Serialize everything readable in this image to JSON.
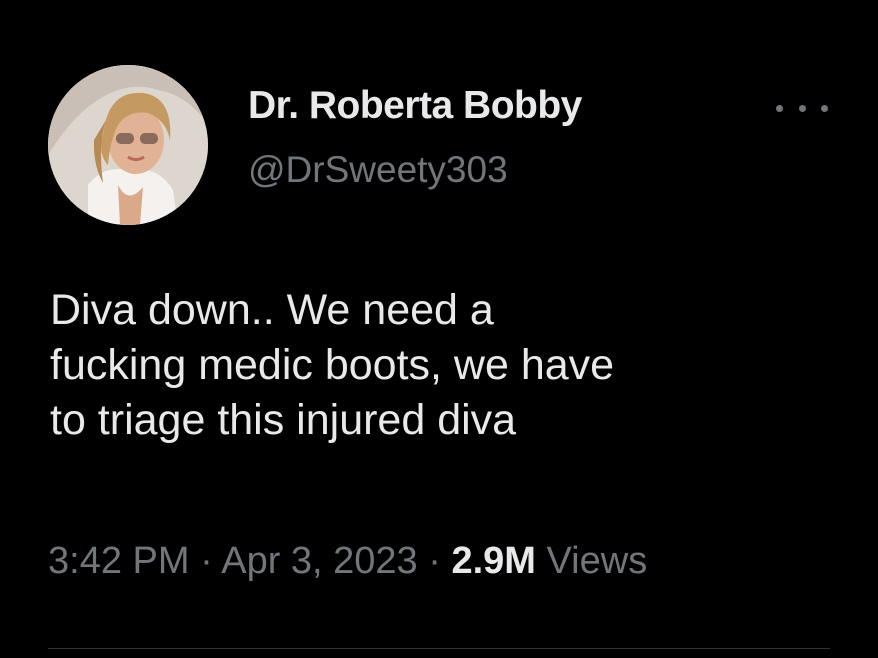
{
  "user": {
    "display_name": "Dr. Roberta Bobby",
    "handle": "@DrSweety303",
    "avatar_icon": "profile-photo"
  },
  "tweet": {
    "lines": [
      "Diva down.. We need a",
      "fucking medic boots, we have",
      "to triage this injured diva"
    ]
  },
  "meta": {
    "time": "3:42 PM",
    "separator": " · ",
    "date": "Apr 3, 2023",
    "views_count": "2.9M",
    "views_label": " Views"
  },
  "icons": {
    "more": "more-horizontal-icon"
  },
  "colors": {
    "background": "#000000",
    "primary_text": "#e7e9ea",
    "secondary_text": "#71767b"
  }
}
